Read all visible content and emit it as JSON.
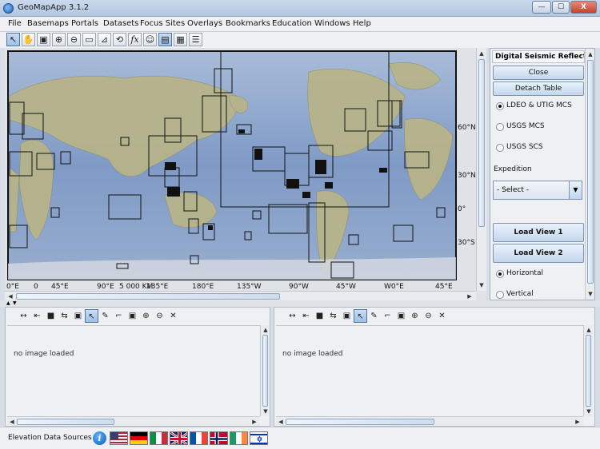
{
  "window": {
    "title": "GeoMapApp 3.1.2",
    "minimize": "—",
    "maximize": "☐",
    "close": "X"
  },
  "menu": [
    "File",
    "Basemaps",
    "Portals",
    "Datasets",
    "Focus Sites",
    "Overlays",
    "Bookmarks",
    "Education",
    "Windows",
    "Help"
  ],
  "toolbar_icons": [
    "pointer-icon",
    "pan-hand-icon",
    "save-icon",
    "zoom-in-icon",
    "zoom-out-icon",
    "rectangle-icon",
    "profile-icon",
    "lasso-icon",
    "function-icon",
    "globe-icon",
    "map-view-icon",
    "grid-icon",
    "list-icon"
  ],
  "map": {
    "lat_labels": [
      "60°N",
      "30°N",
      "0°",
      "30°S"
    ],
    "lon_labels": [
      "0°E",
      "0",
      "45°E",
      "90°E",
      "135°E",
      "180°E",
      "135°W",
      "90°W",
      "45°W",
      "W0°E",
      "45°E"
    ],
    "scale_label": "5 000 KM"
  },
  "side_panel": {
    "title": "Digital Seismic Reflectio...",
    "close_label": "Close",
    "detach_label": "Detach Table",
    "radios": [
      {
        "label": "LDEO & UTIG MCS",
        "selected": true
      },
      {
        "label": "USGS MCS",
        "selected": false
      },
      {
        "label": "USGS SCS",
        "selected": false
      }
    ],
    "expedition_label": "Expedition",
    "expedition_select": "- Select -",
    "load_view_1": "Load View 1",
    "load_view_2": "Load View 2",
    "orientation": [
      {
        "label": "Horizontal",
        "selected": true
      },
      {
        "label": "Vertical",
        "selected": false
      }
    ]
  },
  "image_panels": [
    {
      "message": "no image loaded"
    },
    {
      "message": "no image loaded"
    }
  ],
  "image_toolbar_icons": [
    "widen-icon",
    "narrow-icon",
    "stop-icon",
    "flip-icon",
    "save-icon",
    "pointer-icon",
    "digitize-icon",
    "line-icon",
    "save-image-icon",
    "zoom-in-icon",
    "zoom-out-icon",
    "close-icon"
  ],
  "status": {
    "elevation_label": "Elevation Data Sources",
    "flags": [
      "usa-flag",
      "germany-flag",
      "italy-flag",
      "uk-flag",
      "france-flag",
      "norway-flag",
      "ireland-flag",
      "israel-flag"
    ]
  }
}
